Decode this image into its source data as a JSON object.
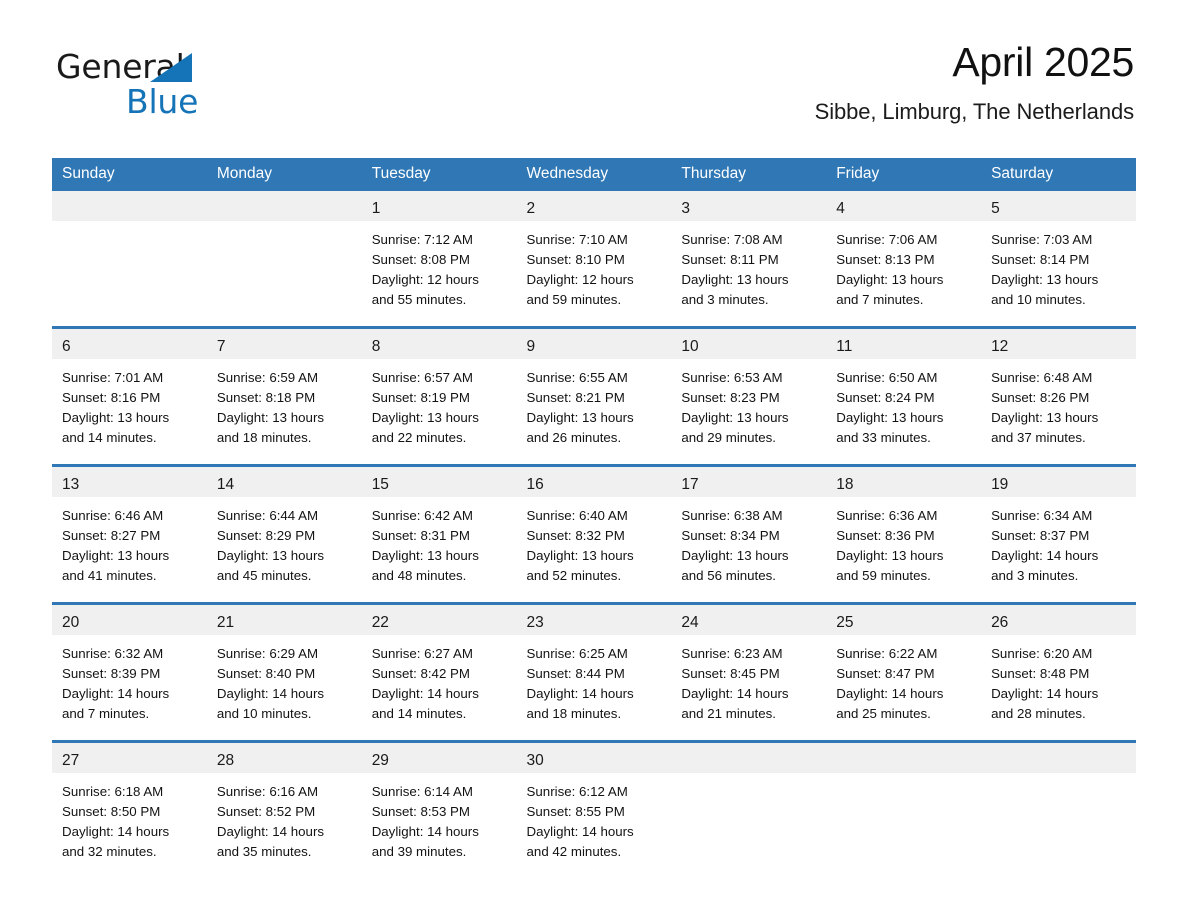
{
  "brand": {
    "name_part1": "General",
    "name_part2": "Blue",
    "accent_color": "#1574b8"
  },
  "header": {
    "title": "April 2025",
    "subtitle": "Sibbe, Limburg, The Netherlands",
    "header_bg_color": "#2f77b5",
    "daynum_bg_color": "#f0f0f0"
  },
  "weekday_headers": [
    "Sunday",
    "Monday",
    "Tuesday",
    "Wednesday",
    "Thursday",
    "Friday",
    "Saturday"
  ],
  "weeks": [
    [
      {
        "day": "",
        "lines": []
      },
      {
        "day": "",
        "lines": []
      },
      {
        "day": "1",
        "lines": [
          "Sunrise: 7:12 AM",
          "Sunset: 8:08 PM",
          "Daylight: 12 hours",
          "and 55 minutes."
        ]
      },
      {
        "day": "2",
        "lines": [
          "Sunrise: 7:10 AM",
          "Sunset: 8:10 PM",
          "Daylight: 12 hours",
          "and 59 minutes."
        ]
      },
      {
        "day": "3",
        "lines": [
          "Sunrise: 7:08 AM",
          "Sunset: 8:11 PM",
          "Daylight: 13 hours",
          "and 3 minutes."
        ]
      },
      {
        "day": "4",
        "lines": [
          "Sunrise: 7:06 AM",
          "Sunset: 8:13 PM",
          "Daylight: 13 hours",
          "and 7 minutes."
        ]
      },
      {
        "day": "5",
        "lines": [
          "Sunrise: 7:03 AM",
          "Sunset: 8:14 PM",
          "Daylight: 13 hours",
          "and 10 minutes."
        ]
      }
    ],
    [
      {
        "day": "6",
        "lines": [
          "Sunrise: 7:01 AM",
          "Sunset: 8:16 PM",
          "Daylight: 13 hours",
          "and 14 minutes."
        ]
      },
      {
        "day": "7",
        "lines": [
          "Sunrise: 6:59 AM",
          "Sunset: 8:18 PM",
          "Daylight: 13 hours",
          "and 18 minutes."
        ]
      },
      {
        "day": "8",
        "lines": [
          "Sunrise: 6:57 AM",
          "Sunset: 8:19 PM",
          "Daylight: 13 hours",
          "and 22 minutes."
        ]
      },
      {
        "day": "9",
        "lines": [
          "Sunrise: 6:55 AM",
          "Sunset: 8:21 PM",
          "Daylight: 13 hours",
          "and 26 minutes."
        ]
      },
      {
        "day": "10",
        "lines": [
          "Sunrise: 6:53 AM",
          "Sunset: 8:23 PM",
          "Daylight: 13 hours",
          "and 29 minutes."
        ]
      },
      {
        "day": "11",
        "lines": [
          "Sunrise: 6:50 AM",
          "Sunset: 8:24 PM",
          "Daylight: 13 hours",
          "and 33 minutes."
        ]
      },
      {
        "day": "12",
        "lines": [
          "Sunrise: 6:48 AM",
          "Sunset: 8:26 PM",
          "Daylight: 13 hours",
          "and 37 minutes."
        ]
      }
    ],
    [
      {
        "day": "13",
        "lines": [
          "Sunrise: 6:46 AM",
          "Sunset: 8:27 PM",
          "Daylight: 13 hours",
          "and 41 minutes."
        ]
      },
      {
        "day": "14",
        "lines": [
          "Sunrise: 6:44 AM",
          "Sunset: 8:29 PM",
          "Daylight: 13 hours",
          "and 45 minutes."
        ]
      },
      {
        "day": "15",
        "lines": [
          "Sunrise: 6:42 AM",
          "Sunset: 8:31 PM",
          "Daylight: 13 hours",
          "and 48 minutes."
        ]
      },
      {
        "day": "16",
        "lines": [
          "Sunrise: 6:40 AM",
          "Sunset: 8:32 PM",
          "Daylight: 13 hours",
          "and 52 minutes."
        ]
      },
      {
        "day": "17",
        "lines": [
          "Sunrise: 6:38 AM",
          "Sunset: 8:34 PM",
          "Daylight: 13 hours",
          "and 56 minutes."
        ]
      },
      {
        "day": "18",
        "lines": [
          "Sunrise: 6:36 AM",
          "Sunset: 8:36 PM",
          "Daylight: 13 hours",
          "and 59 minutes."
        ]
      },
      {
        "day": "19",
        "lines": [
          "Sunrise: 6:34 AM",
          "Sunset: 8:37 PM",
          "Daylight: 14 hours",
          "and 3 minutes."
        ]
      }
    ],
    [
      {
        "day": "20",
        "lines": [
          "Sunrise: 6:32 AM",
          "Sunset: 8:39 PM",
          "Daylight: 14 hours",
          "and 7 minutes."
        ]
      },
      {
        "day": "21",
        "lines": [
          "Sunrise: 6:29 AM",
          "Sunset: 8:40 PM",
          "Daylight: 14 hours",
          "and 10 minutes."
        ]
      },
      {
        "day": "22",
        "lines": [
          "Sunrise: 6:27 AM",
          "Sunset: 8:42 PM",
          "Daylight: 14 hours",
          "and 14 minutes."
        ]
      },
      {
        "day": "23",
        "lines": [
          "Sunrise: 6:25 AM",
          "Sunset: 8:44 PM",
          "Daylight: 14 hours",
          "and 18 minutes."
        ]
      },
      {
        "day": "24",
        "lines": [
          "Sunrise: 6:23 AM",
          "Sunset: 8:45 PM",
          "Daylight: 14 hours",
          "and 21 minutes."
        ]
      },
      {
        "day": "25",
        "lines": [
          "Sunrise: 6:22 AM",
          "Sunset: 8:47 PM",
          "Daylight: 14 hours",
          "and 25 minutes."
        ]
      },
      {
        "day": "26",
        "lines": [
          "Sunrise: 6:20 AM",
          "Sunset: 8:48 PM",
          "Daylight: 14 hours",
          "and 28 minutes."
        ]
      }
    ],
    [
      {
        "day": "27",
        "lines": [
          "Sunrise: 6:18 AM",
          "Sunset: 8:50 PM",
          "Daylight: 14 hours",
          "and 32 minutes."
        ]
      },
      {
        "day": "28",
        "lines": [
          "Sunrise: 6:16 AM",
          "Sunset: 8:52 PM",
          "Daylight: 14 hours",
          "and 35 minutes."
        ]
      },
      {
        "day": "29",
        "lines": [
          "Sunrise: 6:14 AM",
          "Sunset: 8:53 PM",
          "Daylight: 14 hours",
          "and 39 minutes."
        ]
      },
      {
        "day": "30",
        "lines": [
          "Sunrise: 6:12 AM",
          "Sunset: 8:55 PM",
          "Daylight: 14 hours",
          "and 42 minutes."
        ]
      },
      {
        "day": "",
        "lines": []
      },
      {
        "day": "",
        "lines": []
      },
      {
        "day": "",
        "lines": []
      }
    ]
  ]
}
